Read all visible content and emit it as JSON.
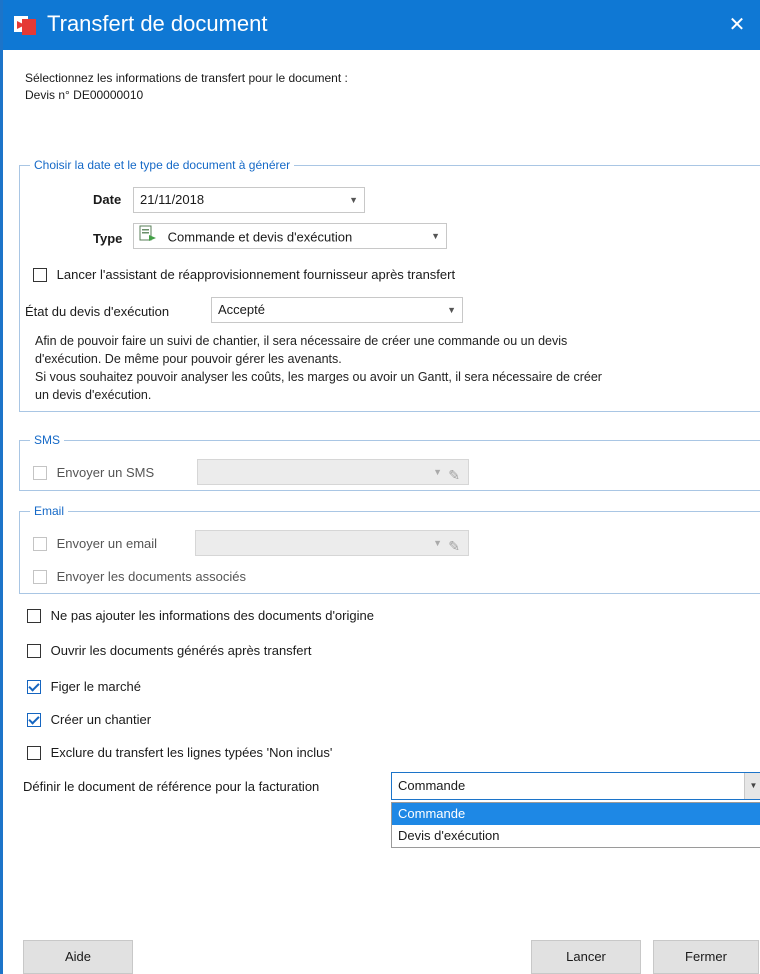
{
  "window": {
    "title": "Transfert de document"
  },
  "intro": {
    "line1": "Sélectionnez les informations de transfert pour le document :",
    "line2": "Devis n° DE00000010"
  },
  "group_date": {
    "legend": "Choisir la date et le type de document à générer",
    "date_label": "Date",
    "date_value": "21/11/2018",
    "type_label": "Type",
    "type_value": "Commande et devis d'exécution",
    "cb_reappro": "Lancer l'assistant de réapprovisionnement fournisseur après transfert",
    "etat_label": "État du devis d'exécution",
    "etat_value": "Accepté",
    "info_line1": "Afin de pouvoir faire un suivi de chantier, il sera nécessaire de créer une commande ou un devis",
    "info_line2": "d'exécution. De même pour pouvoir gérer les avenants.",
    "info_line3": "Si vous souhaitez pouvoir analyser les coûts, les marges ou avoir un Gantt, il sera nécessaire de créer",
    "info_line4": "un devis d'exécution."
  },
  "group_sms": {
    "legend": "SMS",
    "cb_label": "Envoyer un SMS"
  },
  "group_email": {
    "legend": "Email",
    "cb_label": "Envoyer un email",
    "cb_docs": "Envoyer les documents associés"
  },
  "options": {
    "no_origin": "Ne pas ajouter les informations des documents d'origine",
    "open_docs": "Ouvrir les documents générés après transfert",
    "freeze": "Figer le marché",
    "create_site": "Créer un chantier",
    "exclude": "Exclure du transfert les lignes typées 'Non inclus'"
  },
  "reference": {
    "label": "Définir le document de référence pour la facturation",
    "value": "Commande",
    "options": [
      "Commande",
      "Devis d'exécution"
    ]
  },
  "buttons": {
    "help": "Aide",
    "run": "Lancer",
    "close": "Fermer"
  },
  "colors": {
    "titlebar": "#0f78d4",
    "accent": "#1569c7",
    "selected_option": "#1e88e5"
  }
}
